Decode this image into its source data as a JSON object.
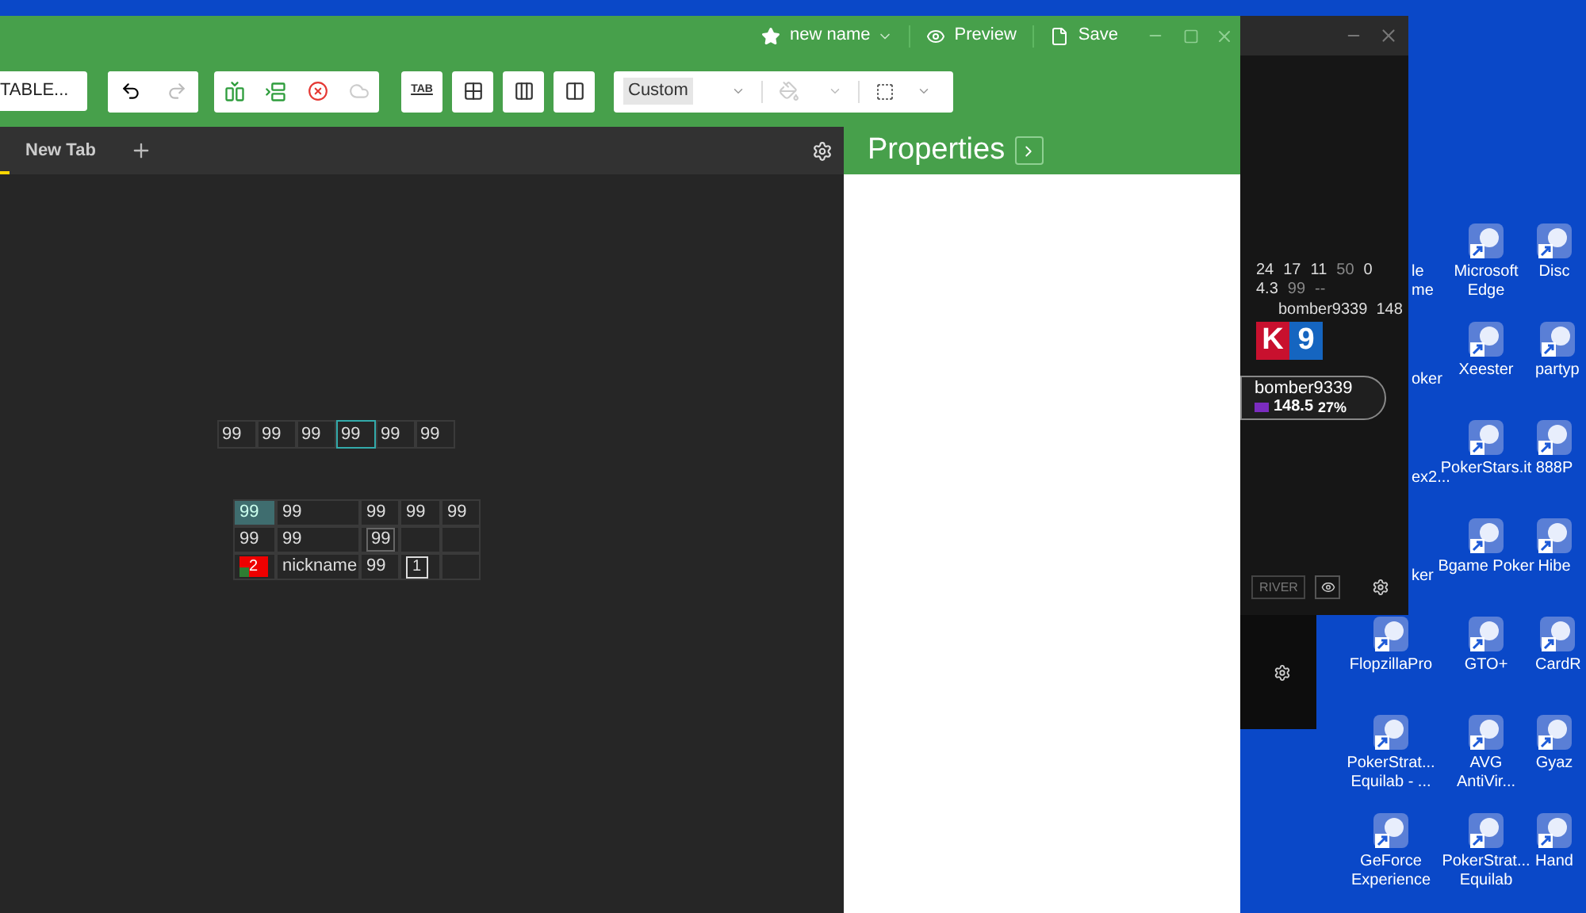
{
  "app": {
    "title": "new name",
    "preview": "Preview",
    "save": "Save",
    "toolbar": {
      "table_button": "TABLE...",
      "tab_button": "TAB",
      "style_select": "Custom"
    },
    "tabs": [
      {
        "label": "New Tab",
        "selected": false
      }
    ],
    "properties": {
      "title": "Properties"
    },
    "canvas": {
      "grids": [
        {
          "rows": [
            [
              {
                "text": "99",
                "kind": "plain",
                "selected": false
              },
              {
                "text": "99",
                "kind": "plain",
                "selected": false
              },
              {
                "text": "99",
                "kind": "plain",
                "selected": false
              },
              {
                "text": "99",
                "kind": "plain",
                "selected": true
              },
              {
                "text": "99",
                "kind": "plain",
                "selected": false
              },
              {
                "text": "99",
                "kind": "plain",
                "selected": false
              }
            ]
          ]
        },
        {
          "rows": [
            [
              {
                "text": "99",
                "kind": "plain",
                "selected": true
              },
              {
                "text": "99",
                "kind": "plain",
                "selected": false
              },
              {
                "text": "99",
                "kind": "plain",
                "selected": false
              },
              {
                "text": "99",
                "kind": "plain",
                "selected": false
              },
              {
                "text": "99",
                "kind": "plain",
                "selected": false
              }
            ],
            [
              {
                "text": "99",
                "kind": "plain",
                "selected": false
              },
              {
                "text": "99",
                "kind": "plain",
                "selected": false
              },
              {
                "text": "99",
                "kind": "framed",
                "selected": false
              },
              {
                "kind": "empty",
                "selected": false
              },
              {
                "kind": "empty",
                "selected": false
              }
            ],
            [
              {
                "text": "2",
                "kind": "seat",
                "selected": false
              },
              {
                "text": "nickname",
                "kind": "plain",
                "selected": false
              },
              {
                "text": "99",
                "kind": "plain",
                "selected": false
              },
              {
                "text": "1",
                "kind": "boxed",
                "selected": false
              },
              {
                "kind": "empty",
                "selected": false
              }
            ]
          ]
        }
      ]
    }
  },
  "hud": {
    "stats": [
      [
        {
          "text": "24",
          "dim": false
        },
        {
          "text": "17",
          "dim": false
        },
        {
          "text": "11",
          "dim": false
        },
        {
          "text": "50",
          "dim": true
        },
        {
          "text": "0",
          "dim": false
        }
      ],
      [
        {
          "text": "4.3",
          "dim": false
        },
        {
          "text": "99",
          "dim": true
        },
        {
          "text": "--",
          "dim": true
        }
      ]
    ],
    "name_line": "bomber9339  148",
    "cards": [
      {
        "rank": "K",
        "color": "#c8102e"
      },
      {
        "rank": "9",
        "color": "#1565c0"
      }
    ],
    "player": {
      "name": "bomber9339",
      "stack": "148.5",
      "percent": "27%"
    },
    "street_button": "RIVER"
  },
  "desktop": {
    "columns": [
      {
        "items": [
          {
            "lines": [
              "le",
              "me"
            ],
            "covered": true
          },
          {
            "lines": [
              "oker"
            ],
            "covered": true
          },
          {
            "lines": [
              "ex2..."
            ],
            "covered": true
          },
          {
            "lines": [
              "ker"
            ],
            "covered": true
          },
          {
            "lines": [
              "FlopzillaPro"
            ],
            "covered": false
          },
          {
            "lines": [
              "PokerStrat...",
              "Equilab - ..."
            ],
            "covered": false
          },
          {
            "lines": [
              "GeForce",
              "Experience"
            ],
            "covered": false
          }
        ]
      },
      {
        "items": [
          {
            "lines": [
              "Microsoft",
              "Edge"
            ],
            "covered": false
          },
          {
            "lines": [
              "Xeester"
            ],
            "covered": false
          },
          {
            "lines": [
              "PokerStars.it"
            ],
            "covered": false
          },
          {
            "lines": [
              "Bgame Poker"
            ],
            "covered": false
          },
          {
            "lines": [
              "GTO+"
            ],
            "covered": false
          },
          {
            "lines": [
              "AVG",
              "AntiVir..."
            ],
            "covered": false
          },
          {
            "lines": [
              "PokerStrat...",
              "Equilab"
            ],
            "covered": false
          }
        ]
      },
      {
        "items": [
          {
            "lines": [
              "Disc"
            ],
            "covered": false
          },
          {
            "lines": [
              "partyp"
            ],
            "covered": false
          },
          {
            "lines": [
              "888P"
            ],
            "covered": false
          },
          {
            "lines": [
              "Hibe"
            ],
            "covered": false
          },
          {
            "lines": [
              "CardR"
            ],
            "covered": false
          },
          {
            "lines": [
              "Gyaz"
            ],
            "covered": false
          },
          {
            "lines": [
              "Hand"
            ],
            "covered": false
          }
        ]
      }
    ]
  }
}
